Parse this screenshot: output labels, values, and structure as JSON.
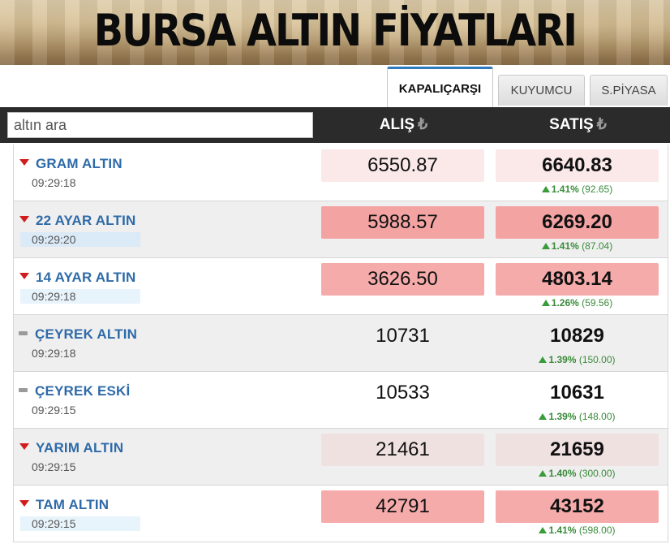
{
  "banner": {
    "title": "BURSA ALTIN FİYATLARI"
  },
  "tabs": [
    {
      "label": "KAPALIÇARŞI",
      "active": true
    },
    {
      "label": "KUYUMCU",
      "active": false
    },
    {
      "label": "S.PİYASA",
      "active": false
    }
  ],
  "search": {
    "placeholder": "altın ara",
    "value": ""
  },
  "columns": {
    "alis": "ALIŞ",
    "satis": "SATIŞ",
    "currency_symbol": "₺"
  },
  "rows": [
    {
      "name": "GRAM ALTIN",
      "time": "09:29:18",
      "direction": "down",
      "alis": "6550.87",
      "satis": "6640.83",
      "change_pct": "1.41%",
      "change_abs": "(92.65)"
    },
    {
      "name": "22 AYAR ALTIN",
      "time": "09:29:20",
      "direction": "down",
      "alis": "5988.57",
      "satis": "6269.20",
      "change_pct": "1.41%",
      "change_abs": "(87.04)"
    },
    {
      "name": "14 AYAR ALTIN",
      "time": "09:29:18",
      "direction": "down",
      "alis": "3626.50",
      "satis": "4803.14",
      "change_pct": "1.26%",
      "change_abs": "(59.56)"
    },
    {
      "name": "ÇEYREK ALTIN",
      "time": "09:29:18",
      "direction": "flat",
      "alis": "10731",
      "satis": "10829",
      "change_pct": "1.39%",
      "change_abs": "(150.00)"
    },
    {
      "name": "ÇEYREK ESKİ",
      "time": "09:29:15",
      "direction": "flat",
      "alis": "10533",
      "satis": "10631",
      "change_pct": "1.39%",
      "change_abs": "(148.00)"
    },
    {
      "name": "YARIM ALTIN",
      "time": "09:29:15",
      "direction": "down",
      "alis": "21461",
      "satis": "21659",
      "change_pct": "1.40%",
      "change_abs": "(300.00)"
    },
    {
      "name": "TAM ALTIN",
      "time": "09:29:15",
      "direction": "down",
      "alis": "42791",
      "satis": "43152",
      "change_pct": "1.41%",
      "change_abs": "(598.00)"
    }
  ],
  "colors": {
    "name_blue": "#2e6aa8",
    "down_red": "#d21c1c",
    "up_green": "#3a9b3a",
    "header_dark": "#2b2b2b"
  }
}
